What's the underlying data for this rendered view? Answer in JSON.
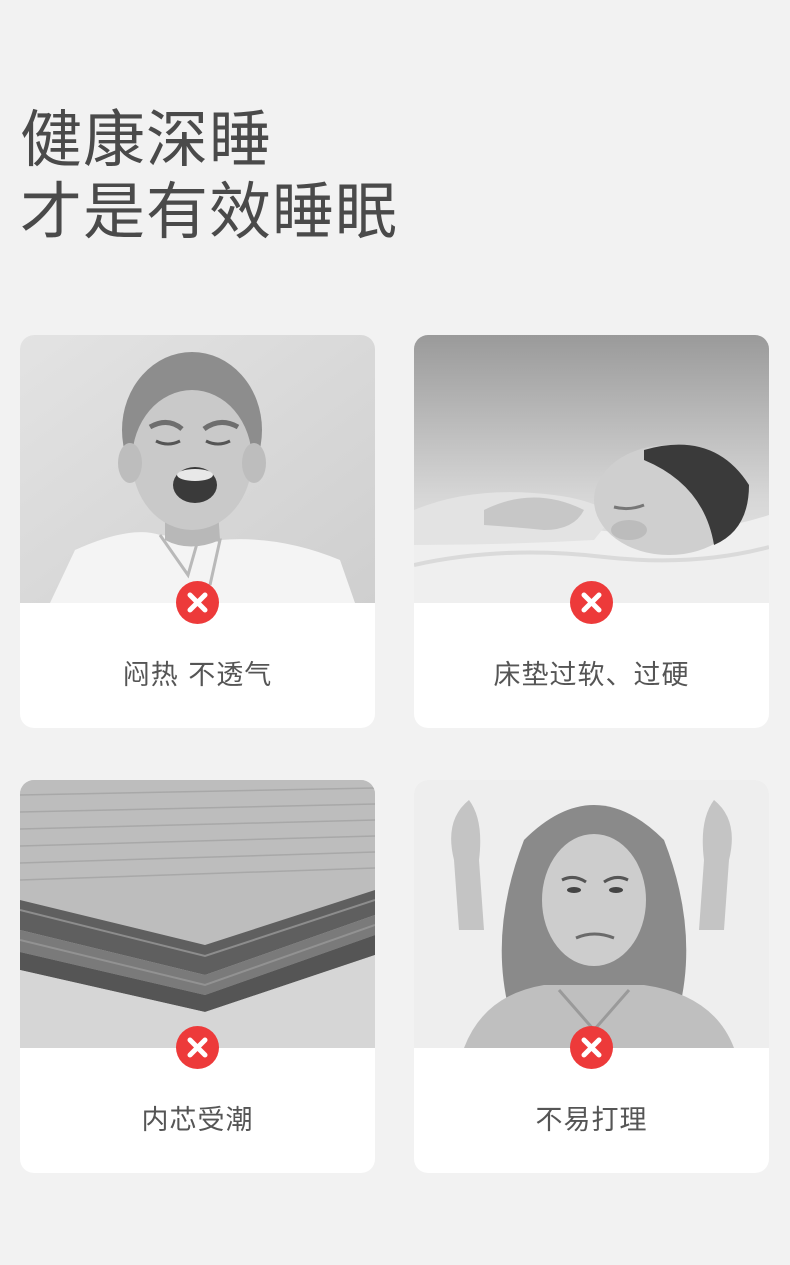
{
  "headline": {
    "line1": "健康深睡",
    "line2": "才是有效睡眠"
  },
  "accent_color": "#ed3a3a",
  "cards": [
    {
      "image": "crying-boy-photo",
      "icon": "cross-icon",
      "label": "闷热 不透气"
    },
    {
      "image": "sleeping-baby-photo",
      "icon": "cross-icon",
      "label": "床垫过软、过硬"
    },
    {
      "image": "mattress-core-layers-photo",
      "icon": "cross-icon",
      "label": "内芯受潮"
    },
    {
      "image": "frustrated-woman-photo",
      "icon": "cross-icon",
      "label": "不易打理"
    }
  ]
}
